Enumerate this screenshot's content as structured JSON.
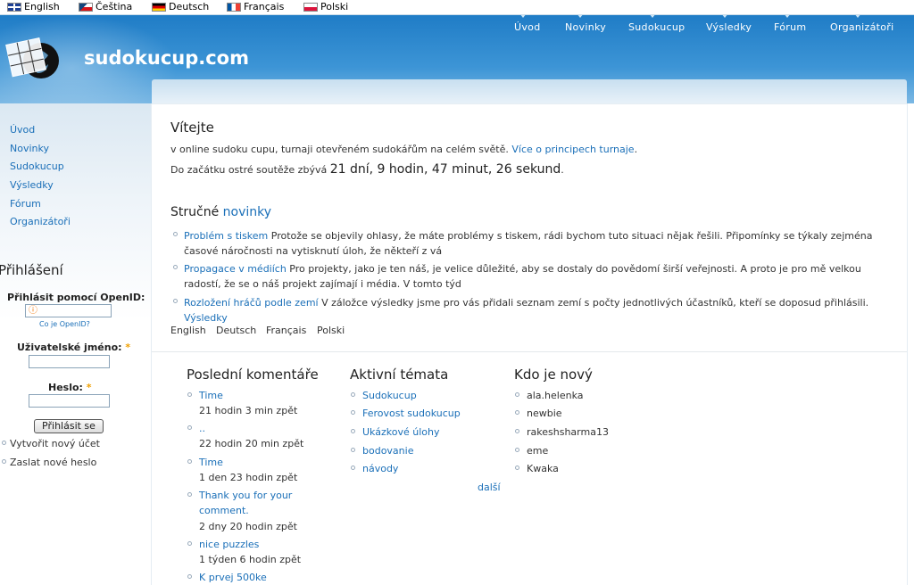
{
  "languages": [
    {
      "label": "English",
      "flag": "uk-flag-icon"
    },
    {
      "label": "Čeština",
      "flag": "czech-flag-icon"
    },
    {
      "label": "Deutsch",
      "flag": "german-flag-icon"
    },
    {
      "label": "Français",
      "flag": "french-flag-icon"
    },
    {
      "label": "Polski",
      "flag": "polish-flag-icon"
    }
  ],
  "site": {
    "name": "sudokucup.com"
  },
  "topnav": [
    "Úvod",
    "Novinky",
    "Sudokucup",
    "Výsledky",
    "Fórum",
    "Organizátoři"
  ],
  "sidebar": {
    "nav": [
      "Úvod",
      "Novinky",
      "Sudokucup",
      "Výsledky",
      "Fórum",
      "Organizátoři"
    ],
    "login": {
      "title": "Přihlášení",
      "openid_label": "Přihlásit pomocí OpenID:",
      "openid_help": "Co je OpenID?",
      "username_label": "Uživatelské jméno:",
      "password_label": "Heslo:",
      "required": "*",
      "submit": "Přihlásit se",
      "create_account": "Vytvořit nový účet",
      "new_password": "Zaslat nové heslo"
    }
  },
  "welcome": {
    "title": "Vítejte",
    "intro": "v online sudoku cupu, turnaji otevřeném sudokářům na celém světě.",
    "intro_link": "Více o principech turnaje",
    "intro_end": ".",
    "countdown_prefix": "Do začátku ostré soutěže zbývá",
    "countdown": "21 dní, 9 hodin, 47 minut, 26 sekund",
    "countdown_end": "."
  },
  "news": {
    "title_plain": "Stručné",
    "title_link": "novinky",
    "items": [
      {
        "link": "Problém s tiskem",
        "text": " Protože se objevily ohlasy, že máte problémy s tiskem, rádi bychom tuto situaci nějak řešili. Připomínky se týkaly zejména časové náročnosti na vytisknutí úloh, že někteří z vá"
      },
      {
        "link": "Propagace v médiích",
        "text": " Pro projekty, jako je ten náš, je velice důležité, aby se dostaly do povědomí širší veřejnosti. A proto je pro mě velkou radostí, že se o náš projekt zajímají i média. V tomto týd"
      },
      {
        "link": "Rozložení hráčů podle zemí",
        "text": " V záložce výsledky jsme pro vás přidali seznam zemí s počty jednotlivých účastníků, kteří se doposud přihlásili. ",
        "link2": "Výsledky"
      }
    ],
    "languages": [
      "English",
      "Deutsch",
      "Français",
      "Polski"
    ]
  },
  "comments": {
    "title": "Poslední komentáře",
    "items": [
      {
        "title": "Time",
        "ago": "21 hodin 3 min zpět"
      },
      {
        "title": "..",
        "ago": "22 hodin 20 min zpět"
      },
      {
        "title": "Time",
        "ago": "1 den 23 hodin zpět"
      },
      {
        "title": "Thank you for your comment.",
        "ago": "2 dny 20 hodin zpět"
      },
      {
        "title": "nice puzzles",
        "ago": "1 týden 6 hodin zpět"
      },
      {
        "title": "K prvej 500ke",
        "ago": ""
      }
    ]
  },
  "topics": {
    "title": "Aktivní témata",
    "items": [
      "Sudokucup",
      "Ferovost sudokucup",
      "Ukázkové úlohy",
      "bodovanie",
      "návody"
    ],
    "more": "další"
  },
  "newusers": {
    "title": "Kdo je nový",
    "items": [
      "ala.helenka",
      "newbie",
      "rakeshsharma13",
      "eme",
      "Kwaka"
    ]
  },
  "colors": {
    "accent": "#1a6fb8",
    "header": "#2b87cc",
    "required": "#f0a000"
  }
}
